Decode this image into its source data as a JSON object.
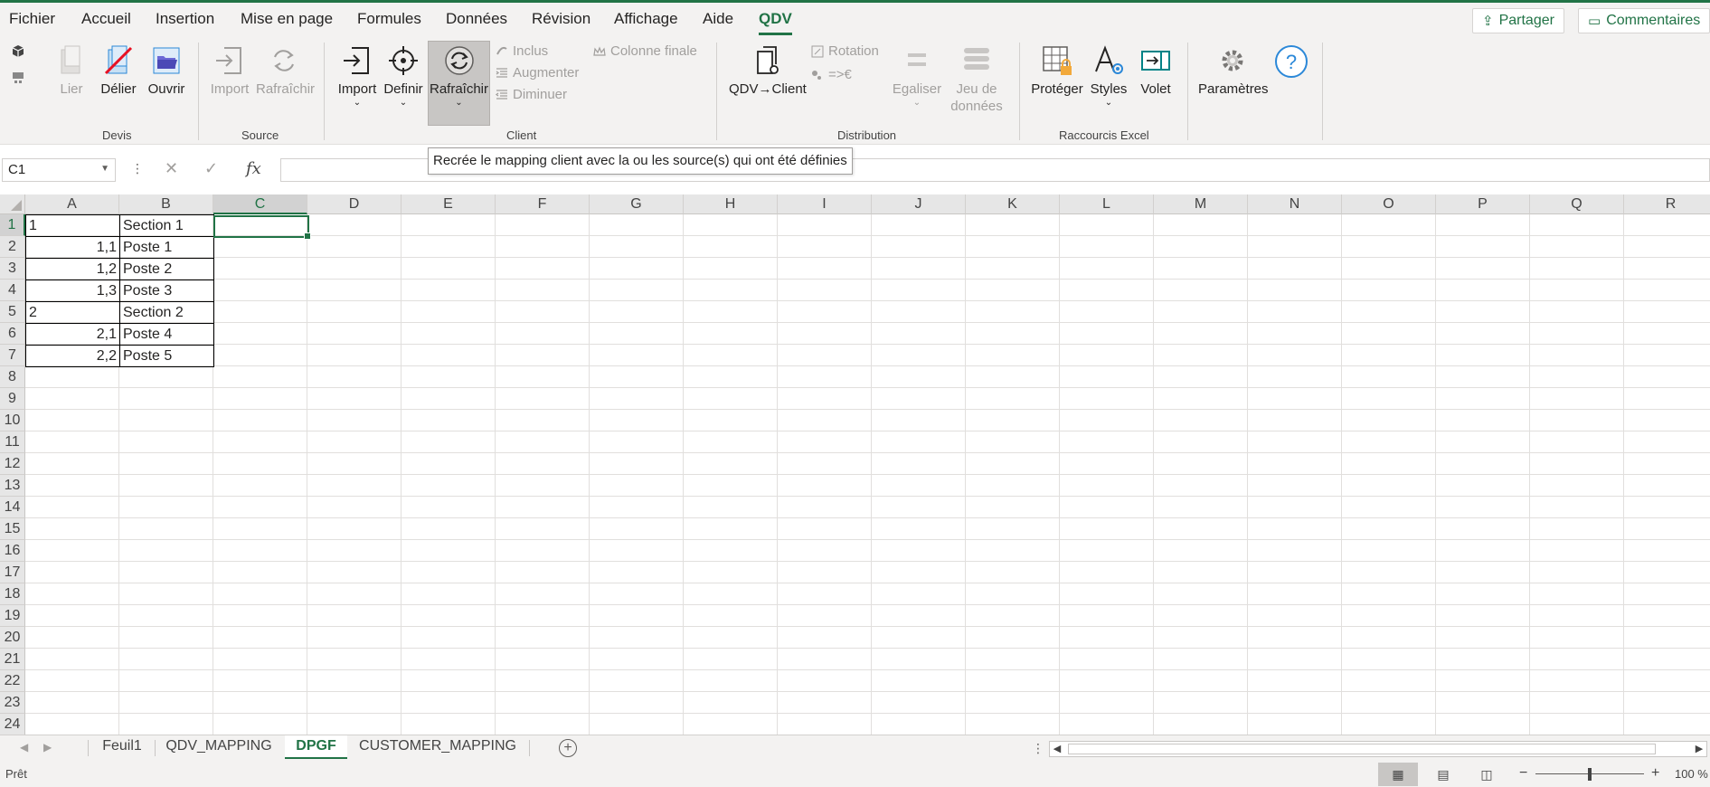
{
  "menu": {
    "tabs": [
      "Fichier",
      "Accueil",
      "Insertion",
      "Mise en page",
      "Formules",
      "Données",
      "Révision",
      "Affichage",
      "Aide",
      "QDV"
    ],
    "active": "QDV",
    "share": "Partager",
    "comments": "Commentaires"
  },
  "ribbon": {
    "groups": {
      "devis": "Devis",
      "source": "Source",
      "client": "Client",
      "distribution": "Distribution",
      "raccourcis": "Raccourcis Excel"
    },
    "buttons": {
      "lier": "Lier",
      "delier": "Délier",
      "ouvrir": "Ouvrir",
      "import_src": "Import",
      "rafraichir_src": "Rafraîchir",
      "import_cli": "Import",
      "definir": "Definir",
      "rafraichir_cli": "Rafraîchir",
      "inclus": "Inclus",
      "augmenter": "Augmenter",
      "diminuer": "Diminuer",
      "colonne_finale": "Colonne finale",
      "qdv_client": "QDV→Client",
      "rotation": "Rotation",
      "conversion": "=>€",
      "egaliser": "Egaliser",
      "jeu_de": "Jeu de",
      "donnees": "données",
      "proteger": "Protéger",
      "styles": "Styles",
      "volet": "Volet",
      "parametres": "Paramètres"
    },
    "tooltip": "Recrée le mapping client avec la ou les source(s) qui ont été définies"
  },
  "formula_bar": {
    "name_box": "C1",
    "formula": ""
  },
  "sheet": {
    "columns": [
      "A",
      "B",
      "C",
      "D",
      "E",
      "F",
      "G",
      "H",
      "I",
      "J",
      "K",
      "L",
      "M",
      "N",
      "O",
      "P",
      "Q",
      "R"
    ],
    "rows": [
      "1",
      "2",
      "3",
      "4",
      "5",
      "6",
      "7",
      "8",
      "9",
      "10",
      "11",
      "12",
      "13",
      "14",
      "15",
      "16",
      "17",
      "18",
      "19",
      "20",
      "21",
      "22",
      "23",
      "24"
    ],
    "selected_col": "C",
    "selected_row": "1",
    "data": [
      {
        "a": "1",
        "b": "Section 1"
      },
      {
        "a": "1,1",
        "b": "Poste 1"
      },
      {
        "a": "1,2",
        "b": "Poste 2"
      },
      {
        "a": "1,3",
        "b": "Poste 3"
      },
      {
        "a": "2",
        "b": "Section 2"
      },
      {
        "a": "2,1",
        "b": "Poste 4"
      },
      {
        "a": "2,2",
        "b": "Poste 5"
      }
    ]
  },
  "sheet_tabs": [
    "Feuil1",
    "QDV_MAPPING",
    "DPGF",
    "CUSTOMER_MAPPING"
  ],
  "active_sheet": "DPGF",
  "status": {
    "text": "Prêt",
    "zoom": "100 %"
  }
}
